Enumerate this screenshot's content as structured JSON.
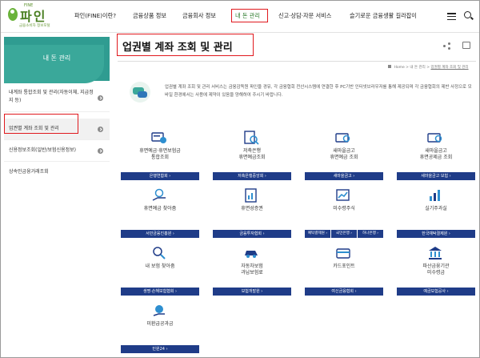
{
  "logo": {
    "top": "FINE",
    "name": "파인",
    "sub": "금융소비자 정보포털"
  },
  "nav": {
    "items": [
      "파인(FINE)이란?",
      "금융상품 정보",
      "금융회사 정보",
      "내 돈 관리",
      "신고·상담·자문 서비스",
      "슬기로운 금융생활 길라잡이"
    ]
  },
  "sidebar": {
    "title": "내 돈 관리",
    "items": [
      {
        "label": "내계좌 통합조회 및 관리(자동이체, 지급정지 등)"
      },
      {
        "label": "업권별 계좌 조회 및 관리"
      },
      {
        "label": "신용정보조회(일반/보험신용정보)"
      },
      {
        "label": "상속인금융거래조회"
      }
    ]
  },
  "main": {
    "title": "업권별 계좌 조회 및 관리",
    "breadcrumb": {
      "home": "Home",
      "level1": "내 돈 관리",
      "current": "업권별 계좌 조회 및 관리"
    },
    "intro": "업권별 계좌 조회 및 관리 서비스는 금융감독원 파인을 경유, 각 금융협회 전산시스템에 연결한 후 PC기반 인터넷브라우저를 통해 제공되며 각 금융협회의 제반 사정으로 모바일 환경에서는 사용에 제약이 있음을 양해하여 주시기 바랍니다.",
    "cards": [
      {
        "label": "휴면예금·휴면보험금\n통합조회",
        "button": "은행연합회"
      },
      {
        "label": "저축은행\n휴면예금조회",
        "button": "저축은행중앙회"
      },
      {
        "label": "새마을금고\n휴면예금 조회",
        "button": "새마을금고"
      },
      {
        "label": "새마을금고\n휴면공제금 조회",
        "button": "새마을금고 보험"
      },
      {
        "label": "휴면예금 찾아줌",
        "button": "서민금융진흥원"
      },
      {
        "label": "휴면성증권",
        "button": "금융투자협회"
      },
      {
        "label": "미수령주식",
        "button_a": "예탁결제원",
        "button_b": "국민은행",
        "button_c": "하나은행"
      },
      {
        "label": "실기주과실",
        "button": "한국예탁결제원"
      },
      {
        "label": "내 보험 찾아줌",
        "button": "생명·손해보험협회"
      },
      {
        "label": "자동차보험\n과납보험료",
        "button": "보험개발원"
      },
      {
        "label": "카드포인트",
        "button": "여신금융협회"
      },
      {
        "label": "파산금융기관\n미수령금",
        "button": "예금보험공사"
      },
      {
        "label": "미환급공과금",
        "button": "민원24"
      }
    ]
  },
  "colors": {
    "accent_teal": "#3aa89a",
    "button_navy": "#1f3c88",
    "highlight_red": "#e0191e"
  }
}
